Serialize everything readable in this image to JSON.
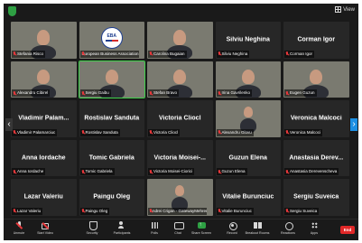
{
  "topbar": {
    "view_label": "View"
  },
  "tiles": [
    {
      "id": "t1",
      "big": "",
      "label": "Stefania Risco",
      "video": true,
      "bg": "bg-a"
    },
    {
      "id": "t2",
      "big": "",
      "label": "European Business Association M...",
      "video": true,
      "bg": "bg-b",
      "logo": "EBA"
    },
    {
      "id": "t3",
      "big": "",
      "label": "Carolina Bugaian",
      "video": true,
      "bg": "bg-c"
    },
    {
      "id": "t4",
      "big": "Silviu Neghina",
      "label": "Silviu Neghina",
      "video": false
    },
    {
      "id": "t5",
      "big": "Corman Igor",
      "label": "Corman Igor",
      "video": false
    },
    {
      "id": "t6",
      "big": "",
      "label": "Alexandru Cibirel",
      "video": true,
      "bg": "bg-d"
    },
    {
      "id": "t7",
      "big": "",
      "label": "Sergiu Gaibu",
      "video": true,
      "bg": "bg-e",
      "speaking": true
    },
    {
      "id": "t8",
      "big": "",
      "label": "Stefan Bravo",
      "video": true,
      "bg": "bg-f"
    },
    {
      "id": "t9",
      "big": "",
      "label": "Irina Gavrilenko",
      "video": true,
      "bg": "bg-g"
    },
    {
      "id": "t10",
      "big": "",
      "label": "Eugen Guzun",
      "video": true,
      "bg": "bg-h"
    },
    {
      "id": "t11",
      "big": "Vladimir Palam...",
      "label": "Vladimir Palamarciuc",
      "video": false
    },
    {
      "id": "t12",
      "big": "Rostislav Sanduta",
      "label": "Rostislav Sanduta",
      "video": false
    },
    {
      "id": "t13",
      "big": "Victoria Cliocl",
      "label": "Victoria Cliocl",
      "video": false
    },
    {
      "id": "t14",
      "big": "",
      "label": "Alexandru Glovu",
      "video": true,
      "bg": "bg-i",
      "small_photo": true
    },
    {
      "id": "t15",
      "big": "Veronica Malcoci",
      "label": "Veronica Malcoci",
      "video": false
    },
    {
      "id": "t16",
      "big": "Anna Iordache",
      "label": "Anna Iordache",
      "video": false
    },
    {
      "id": "t17",
      "big": "Tomic Gabriela",
      "label": "Tomic Gabriela",
      "video": false
    },
    {
      "id": "t18",
      "big": "Victoria Moisei-...",
      "label": "Victoria Moisei-Ciorici",
      "video": false
    },
    {
      "id": "t19",
      "big": "Guzun Elena",
      "label": "Guzun Elena",
      "video": false
    },
    {
      "id": "t20",
      "big": "Anastasia Derev...",
      "label": "Anastasia Derevenscheva",
      "video": false
    },
    {
      "id": "t21",
      "big": "Lazar Valeriu",
      "label": "Lazar Valeriu",
      "video": false
    },
    {
      "id": "t22",
      "big": "Paingu Oleg",
      "label": "Paingu Oleg",
      "video": false
    },
    {
      "id": "t23",
      "big": "",
      "label": "Andrei Crigan - GatewayMehrenr",
      "video": true,
      "bg": "bg-i",
      "small_photo": true
    },
    {
      "id": "t24",
      "big": "Vitalie Burunciuc",
      "label": "Vitalie Burunciuc",
      "video": false
    },
    {
      "id": "t25",
      "big": "Sergiu Suveica",
      "label": "Sergiu Suveica",
      "video": false
    }
  ],
  "toolbar": {
    "unmute": "Unmute",
    "start_video": "Start Video",
    "security": "Security",
    "participants": "Participants",
    "participants_count": "83",
    "polls": "Polls",
    "chat": "Chat",
    "share_screen": "Share Screen",
    "record": "Record",
    "breakout_rooms": "Breakout Rooms",
    "reactions": "Reactions",
    "apps": "Apps",
    "end": "End"
  },
  "colors": {
    "accent_green": "#3ecf4a",
    "end_red": "#e02828",
    "nav_blue": "#1c8fe3"
  }
}
